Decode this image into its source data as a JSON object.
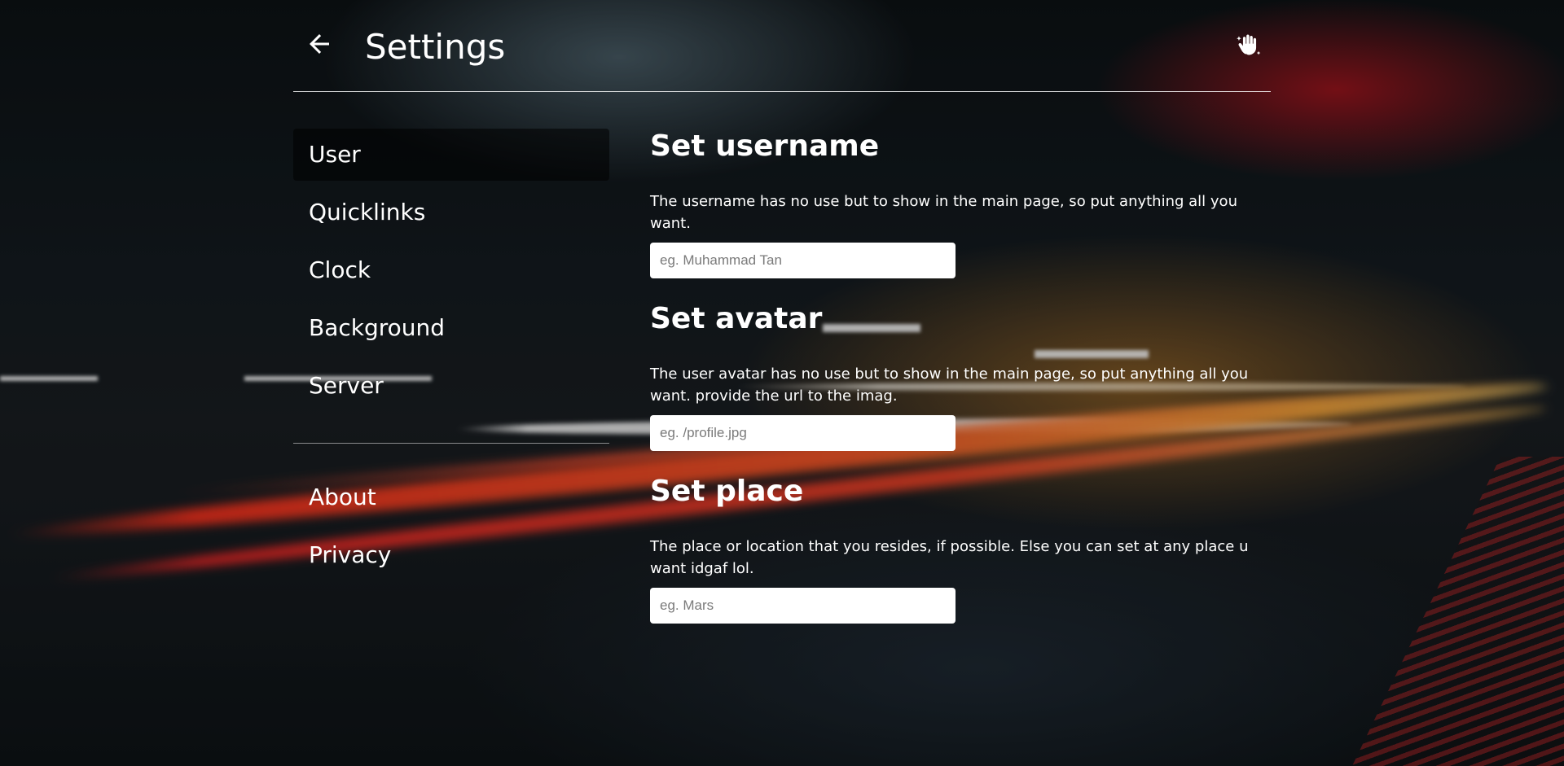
{
  "header": {
    "title": "Settings",
    "back_icon": "arrow-left-icon",
    "action_icon": "waving-hand-sparkle-icon"
  },
  "sidebar": {
    "items": [
      {
        "label": "User",
        "active": true
      },
      {
        "label": "Quicklinks",
        "active": false
      },
      {
        "label": "Clock",
        "active": false
      },
      {
        "label": "Background",
        "active": false
      },
      {
        "label": "Server",
        "active": false
      }
    ],
    "secondary_items": [
      {
        "label": "About"
      },
      {
        "label": "Privacy"
      }
    ]
  },
  "sections": {
    "username": {
      "title": "Set username",
      "description": "The username has no use but to show in the main page, so put anything all you want.",
      "placeholder": "eg. Muhammad Tan"
    },
    "avatar": {
      "title": "Set avatar",
      "description": "The user avatar has no use but to show in the main page, so put anything all you want. provide the url to the imag.",
      "placeholder": "eg. /profile.jpg"
    },
    "place": {
      "title": "Set place",
      "description": "The place or location that you resides, if possible. Else you can set at any place u want idgaf lol.",
      "placeholder": "eg. Mars"
    }
  },
  "colors": {
    "text": "#ffffff",
    "active_nav_bg": "#000000",
    "input_bg": "#ffffff"
  }
}
